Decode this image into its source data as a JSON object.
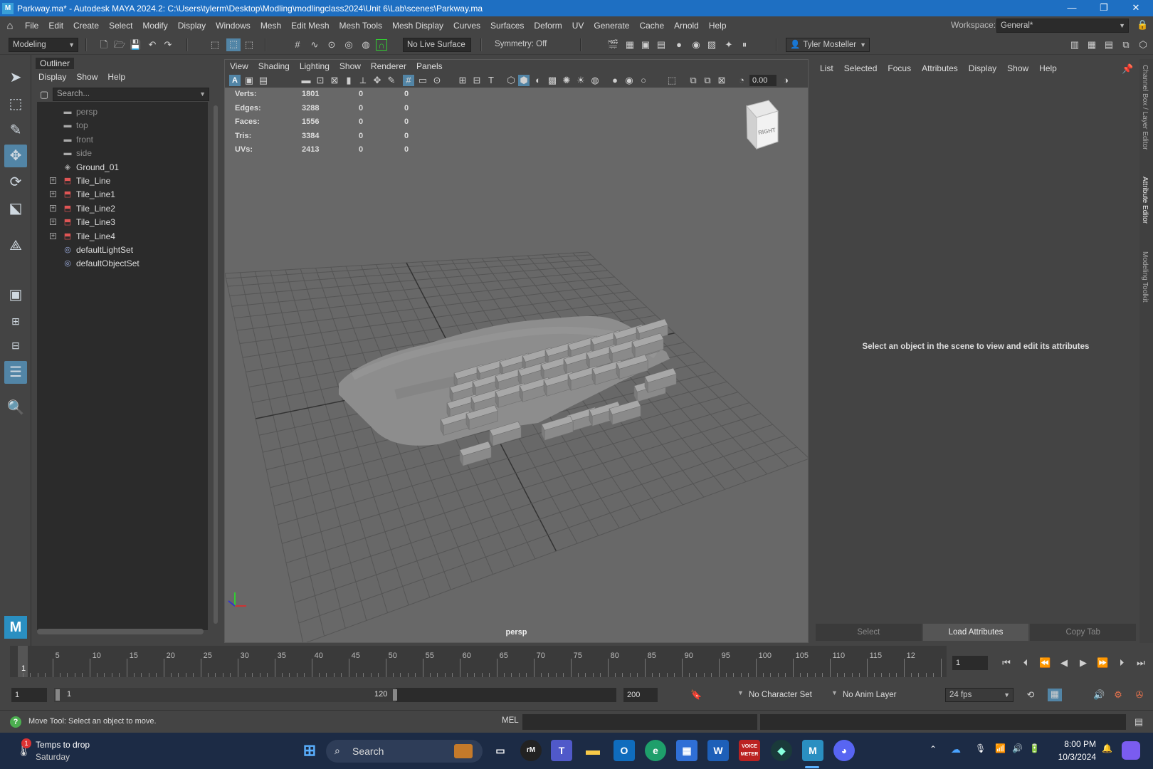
{
  "window": {
    "title": "Parkway.ma* - Autodesk MAYA 2024.2: C:\\Users\\tylerm\\Desktop\\Modling\\modlingclass2024\\Unit 6\\Lab\\scenes\\Parkway.ma",
    "controls": [
      "—",
      "❐",
      "✕"
    ]
  },
  "menubar": {
    "items": [
      "File",
      "Edit",
      "Create",
      "Select",
      "Modify",
      "Display",
      "Windows",
      "Mesh",
      "Edit Mesh",
      "Mesh Tools",
      "Mesh Display",
      "Curves",
      "Surfaces",
      "Deform",
      "UV",
      "Generate",
      "Cache",
      "Arnold",
      "Help"
    ],
    "workspace_label": "Workspace:",
    "workspace_value": "General*"
  },
  "shelf": {
    "mode": "Modeling",
    "live_surface": "No Live Surface",
    "symmetry": "Symmetry: Off",
    "user": "Tyler Mosteller"
  },
  "outliner": {
    "title": "Outliner",
    "menu": [
      "Display",
      "Show",
      "Help"
    ],
    "search_placeholder": "Search...",
    "items": [
      {
        "label": "persp",
        "icon": "camera-icon",
        "expandable": false,
        "dim": true
      },
      {
        "label": "top",
        "icon": "camera-icon",
        "expandable": false,
        "dim": true
      },
      {
        "label": "front",
        "icon": "camera-icon",
        "expandable": false,
        "dim": true
      },
      {
        "label": "side",
        "icon": "camera-icon",
        "expandable": false,
        "dim": true
      },
      {
        "label": "Ground_01",
        "icon": "mesh-icon",
        "expandable": false,
        "dim": false
      },
      {
        "label": "Tile_Line",
        "icon": "group-icon",
        "expandable": true,
        "dim": false
      },
      {
        "label": "Tile_Line1",
        "icon": "group-icon",
        "expandable": true,
        "dim": false
      },
      {
        "label": "Tile_Line2",
        "icon": "group-icon",
        "expandable": true,
        "dim": false
      },
      {
        "label": "Tile_Line3",
        "icon": "group-icon",
        "expandable": true,
        "dim": false
      },
      {
        "label": "Tile_Line4",
        "icon": "group-icon",
        "expandable": true,
        "dim": false
      },
      {
        "label": "defaultLightSet",
        "icon": "set-icon",
        "expandable": false,
        "dim": false
      },
      {
        "label": "defaultObjectSet",
        "icon": "set-icon",
        "expandable": false,
        "dim": false
      }
    ]
  },
  "viewport": {
    "menu": [
      "View",
      "Shading",
      "Lighting",
      "Show",
      "Renderer",
      "Panels"
    ],
    "exposure": "0.00",
    "camera_label": "persp",
    "viewcube_label": "RIGHT",
    "hud": [
      {
        "label": "Verts:",
        "v1": "1801",
        "v2": "0",
        "v3": "0"
      },
      {
        "label": "Edges:",
        "v1": "3288",
        "v2": "0",
        "v3": "0"
      },
      {
        "label": "Faces:",
        "v1": "1556",
        "v2": "0",
        "v3": "0"
      },
      {
        "label": "Tris:",
        "v1": "3384",
        "v2": "0",
        "v3": "0"
      },
      {
        "label": "UVs:",
        "v1": "2413",
        "v2": "0",
        "v3": "0"
      }
    ]
  },
  "attribute_editor": {
    "menu": [
      "List",
      "Selected",
      "Focus",
      "Attributes",
      "Display",
      "Show",
      "Help"
    ],
    "message": "Select an object in the scene to view and edit its attributes",
    "buttons": [
      "Select",
      "Load Attributes",
      "Copy Tab"
    ]
  },
  "side_tabs": [
    "Channel Box / Layer Editor",
    "Attribute Editor",
    "Modeling Toolkit"
  ],
  "timeline": {
    "ticks": [
      "5",
      "10",
      "15",
      "20",
      "25",
      "30",
      "35",
      "40",
      "45",
      "50",
      "55",
      "60",
      "65",
      "70",
      "75",
      "80",
      "85",
      "90",
      "95",
      "100",
      "105",
      "110",
      "115",
      "12"
    ],
    "current_frame_marker": "1",
    "current_frame": "1"
  },
  "range": {
    "start": "1",
    "inner_start": "1",
    "inner_end": "120",
    "end": "200",
    "character_set": "No Character Set",
    "anim_layer": "No Anim Layer",
    "fps": "24 fps"
  },
  "status": {
    "help_text": "Move Tool: Select an object to move.",
    "mel_label": "MEL"
  },
  "taskbar": {
    "weather_title": "Temps to drop",
    "weather_sub": "Saturday",
    "weather_badge": "1",
    "search": "Search",
    "time": "8:00 PM",
    "date": "10/3/2024",
    "voice_label": "VOICE METER"
  },
  "colors": {
    "titlebar": "#1e6fc2",
    "panel": "#444444",
    "viewport_bg": "#686868",
    "accent": "#5285a6",
    "taskbar": "#1c2b45"
  }
}
